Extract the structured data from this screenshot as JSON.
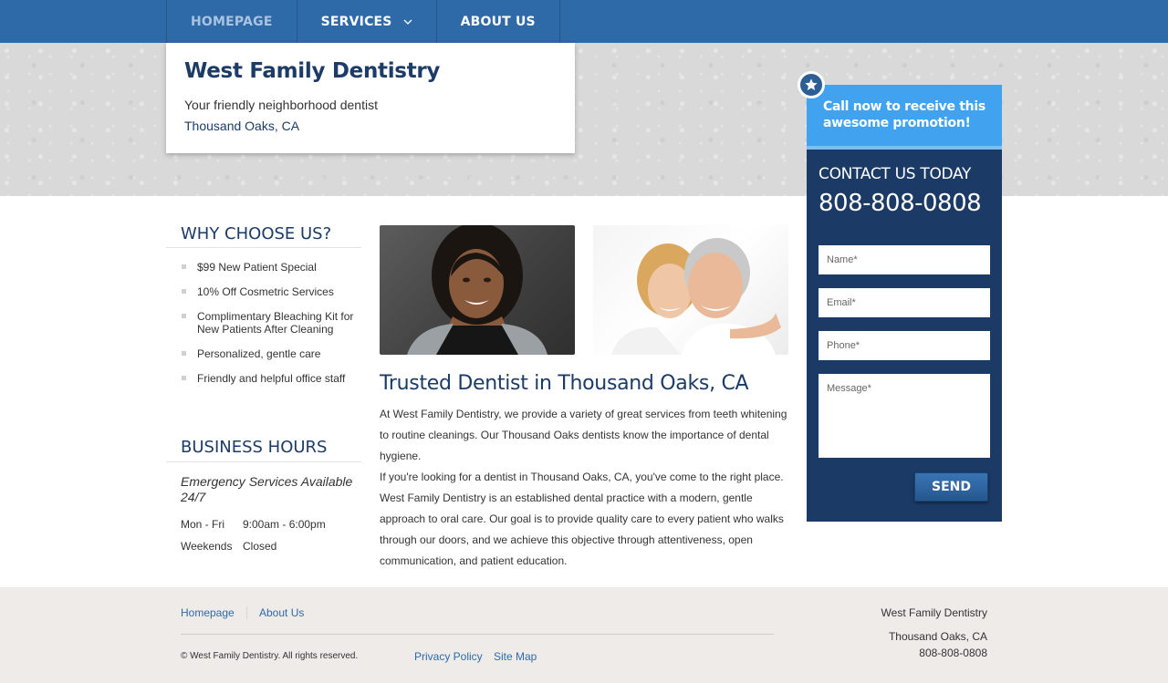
{
  "nav": {
    "items": [
      {
        "label": "HOMEPAGE"
      },
      {
        "label": "SERVICES"
      },
      {
        "label": "ABOUT US"
      }
    ]
  },
  "brand": {
    "title": "West Family Dentistry",
    "tagline": "Your friendly neighborhood dentist",
    "location": "Thousand Oaks, CA"
  },
  "why": {
    "title": "WHY CHOOSE US?",
    "items": [
      "$99 New Patient Special",
      "10% Off Cosmetric Services",
      "Complimentary Bleaching Kit for New Patients After Cleaning",
      "Personalized, gentle care",
      "Friendly and helpful office staff"
    ]
  },
  "hours": {
    "title": "BUSINESS HOURS",
    "emergency": "Emergency Services Available 24/7",
    "rows": [
      {
        "day": "Mon - Fri",
        "time": "9:00am - 6:00pm"
      },
      {
        "day": "Weekends",
        "time": "Closed"
      }
    ]
  },
  "main": {
    "title": "Trusted Dentist in Thousand Oaks, CA",
    "para1": "At West Family Dentistry, we provide a variety of great services from teeth whitening to routine cleanings. Our Thousand Oaks dentists know the importance of dental hygiene.",
    "para2": "If you're looking for a dentist in Thousand Oaks, CA, you've come to the right place. West Family Dentistry is an established dental practice with a modern, gentle approach to oral care. Our goal is to provide quality care to every patient who walks through our doors, and we achieve this objective through attentiveness, open communication, and patient education."
  },
  "promo": {
    "text": "Call now to receive this awesome promotion!",
    "contact_label": "CONTACT US TODAY",
    "phone": "808-808-0808",
    "fields": {
      "name": "Name*",
      "email": "Email*",
      "phone": "Phone*",
      "message": "Message*"
    },
    "send": "SEND"
  },
  "footer": {
    "links": [
      "Homepage",
      "About Us"
    ],
    "copyright": "© West Family Dentistry. All rights reserved.",
    "bottom_links": [
      "Privacy Policy",
      "Site Map"
    ],
    "business": "West Family Dentistry",
    "city": "Thousand Oaks, CA",
    "phone": "808-808-0808"
  },
  "colors": {
    "nav": "#2e6aa8",
    "heading": "#1c3b66",
    "promo": "#41a3f0",
    "contact_panel": "#1b3b66",
    "footer": "#efebe8"
  }
}
